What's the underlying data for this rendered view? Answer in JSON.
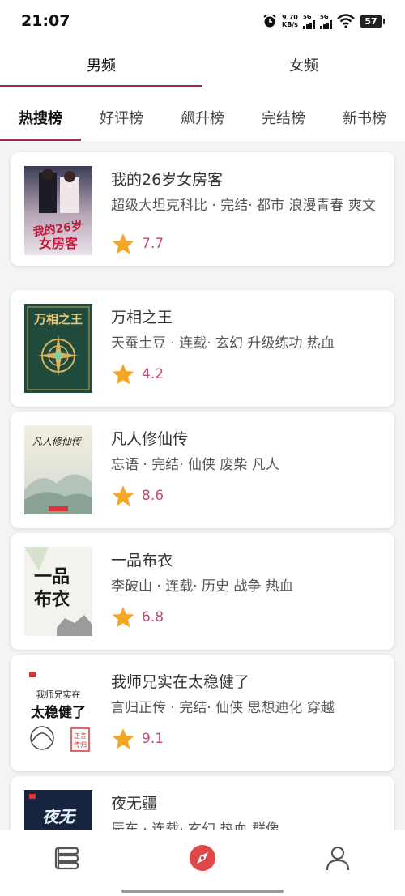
{
  "status_bar": {
    "time": "21:07",
    "net_speed_value": "9.70",
    "net_speed_unit": "KB/s",
    "signal_1": "5G",
    "signal_2": "5G",
    "battery": "57",
    "icons": [
      "alarm-icon",
      "signal-icon",
      "wifi-icon",
      "battery-icon"
    ]
  },
  "gender_tabs": [
    {
      "label": "男频",
      "active": true
    },
    {
      "label": "女频",
      "active": false
    }
  ],
  "rank_tabs": [
    {
      "label": "热搜榜",
      "active": true
    },
    {
      "label": "好评榜",
      "active": false
    },
    {
      "label": "飙升榜",
      "active": false
    },
    {
      "label": "完结榜",
      "active": false
    },
    {
      "label": "新书榜",
      "active": false
    }
  ],
  "books": [
    {
      "title": "我的26岁女房客",
      "meta": "超级大坦克科比 · 完结· 都市 浪漫青春 爽文",
      "score": "7.7",
      "cover_text": "我的26岁女房客"
    },
    {
      "title": "万相之王",
      "meta": "天蚕土豆 · 连载· 玄幻 升级练功 热血",
      "score": "4.2",
      "cover_text": "万相之王"
    },
    {
      "title": "凡人修仙传",
      "meta": "忘语 · 完结· 仙侠 废柴 凡人",
      "score": "8.6",
      "cover_text": "凡人修仙传"
    },
    {
      "title": "一品布衣",
      "meta": "李破山 · 连载· 历史 战争 热血",
      "score": "6.8",
      "cover_text": "一品布衣"
    },
    {
      "title": "我师兄实在太稳健了",
      "meta": "言归正传 · 完结· 仙侠 思想迪化 穿越",
      "score": "9.1",
      "cover_text_1": "我师兄实在",
      "cover_text_2": "太稳健了",
      "cover_seal": "正言传归"
    },
    {
      "title": "夜无疆",
      "meta": "辰东 · 连载· 玄幻 热血 群像",
      "score": "",
      "cover_text": "夜无疆"
    }
  ],
  "bottom_nav": [
    {
      "icon": "bookshelf-icon",
      "active": false
    },
    {
      "icon": "compass-icon",
      "active": true
    },
    {
      "icon": "user-icon",
      "active": false
    }
  ],
  "colors": {
    "accent": "#a62a44",
    "score": "#c9486d",
    "star": "#f5a623",
    "list_bg": "#f4f4f4"
  }
}
